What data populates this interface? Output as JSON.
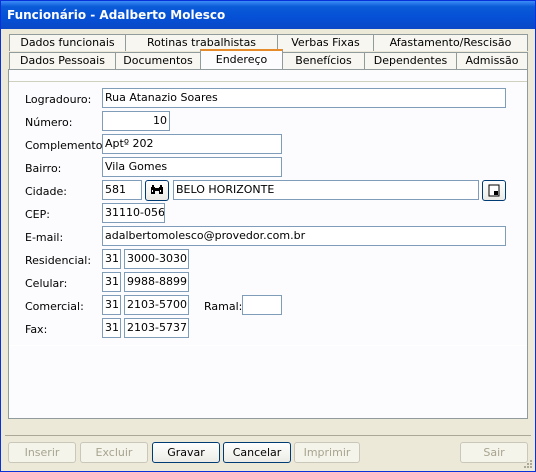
{
  "window": {
    "title": "Funcionário - Adalberto Molesco"
  },
  "tabs_row1": [
    "Dados funcionais",
    "Rotinas trabalhistas",
    "Verbas Fixas",
    "Afastamento/Rescisão"
  ],
  "tabs_row2": [
    "Dados Pessoais",
    "Documentos",
    "Endereço",
    "Benefícios",
    "Dependentes",
    "Admissão"
  ],
  "active_tab": "Endereço",
  "form": {
    "logradouro": {
      "label": "Logradouro:",
      "value": "Rua Atanazio Soares"
    },
    "numero": {
      "label": "Número:",
      "value": "10"
    },
    "complemento": {
      "label": "Complemento:",
      "value": "Aptº 202"
    },
    "bairro": {
      "label": "Bairro:",
      "value": "Vila Gomes"
    },
    "cidade": {
      "label": "Cidade:",
      "code": "581",
      "name": "BELO HORIZONTE"
    },
    "cep": {
      "label": "CEP:",
      "value": "31110-056"
    },
    "email": {
      "label": "E-mail:",
      "value": "adalbertomolesco@provedor.com.br"
    },
    "residencial": {
      "label": "Residencial:",
      "ddd": "31",
      "number": "3000-3030"
    },
    "celular": {
      "label": "Celular:",
      "ddd": "31",
      "number": "9988-8899"
    },
    "comercial": {
      "label": "Comercial:",
      "ddd": "31",
      "number": "2103-5700",
      "ramal_label": "Ramal:",
      "ramal": ""
    },
    "fax": {
      "label": "Fax:",
      "ddd": "31",
      "number": "2103-5737"
    }
  },
  "buttons": {
    "inserir": "Inserir",
    "excluir": "Excluir",
    "gravar": "Gravar",
    "cancelar": "Cancelar",
    "imprimir": "Imprimir",
    "sair": "Sair"
  }
}
